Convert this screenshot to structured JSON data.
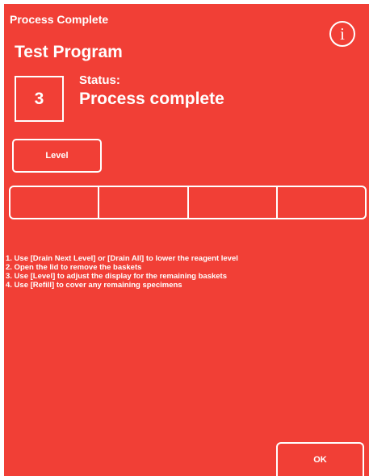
{
  "header": {
    "title": "Process Complete",
    "info_icon": "info-icon",
    "info_glyph": "i"
  },
  "program": {
    "name": "Test Program"
  },
  "status": {
    "step_number": "3",
    "label": "Status:",
    "value": "Process complete"
  },
  "level": {
    "button_label": "Level",
    "segment_count": 4
  },
  "instructions": [
    "1. Use [Drain Next Level] or [Drain All] to lower the reagent level",
    "2. Open the lid to remove the baskets",
    "3. Use [Level] to adjust the display for the remaining baskets",
    "4. Use [Refill] to cover any remaining specimens"
  ],
  "footer": {
    "ok_label": "OK"
  },
  "colors": {
    "background": "#f13f36",
    "foreground": "#ffffff"
  }
}
